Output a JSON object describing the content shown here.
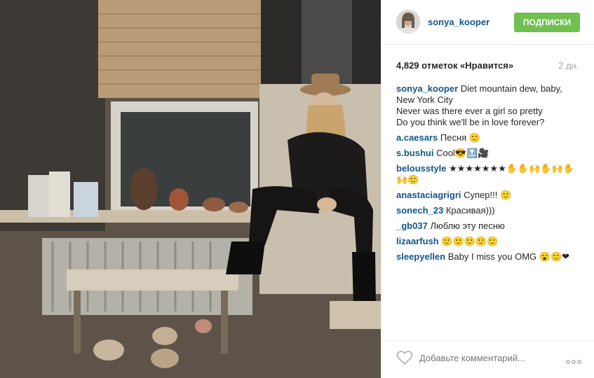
{
  "post": {
    "username": "sonya_kooper",
    "follow_label": "ПОДПИСКИ",
    "likes_text": "4,829 отметок «Нравится»",
    "age": "2 дн.",
    "add_comment_placeholder": "Добавьте комментарий...",
    "caption": {
      "user": "sonya_kooper",
      "text": "Diet mountain dew, baby,\nNew York City\nNever was there ever a girl so pretty\nDo you think we'll be in love forever?"
    },
    "comments": [
      {
        "user": "a.caesars",
        "text": "Песня 🙂"
      },
      {
        "user": "s.bushui",
        "text": "Cool😎🔝🎥"
      },
      {
        "user": "belousstyle",
        "text": "★★★★★★★✋✋🙌✋🙌✋🙌🙂"
      },
      {
        "user": "anastaciagrigri",
        "text": "Супер!!! 🙂"
      },
      {
        "user": "sonech_23",
        "text": "Красивая)))"
      },
      {
        "user": "_gb037",
        "text": "Люблю эту песню"
      },
      {
        "user": "lizaarfush",
        "text": "🙂🙂🙂🙂🙂"
      },
      {
        "user": "sleepyellen",
        "text": "Baby I miss you OMG 😮🙂❤"
      }
    ]
  },
  "icons": {
    "like": "heart-outline-icon",
    "more": "more-options-icon"
  },
  "colors": {
    "link": "#125688",
    "follow_button": "#70c050",
    "muted": "#a5a7aa",
    "text": "#262626"
  }
}
